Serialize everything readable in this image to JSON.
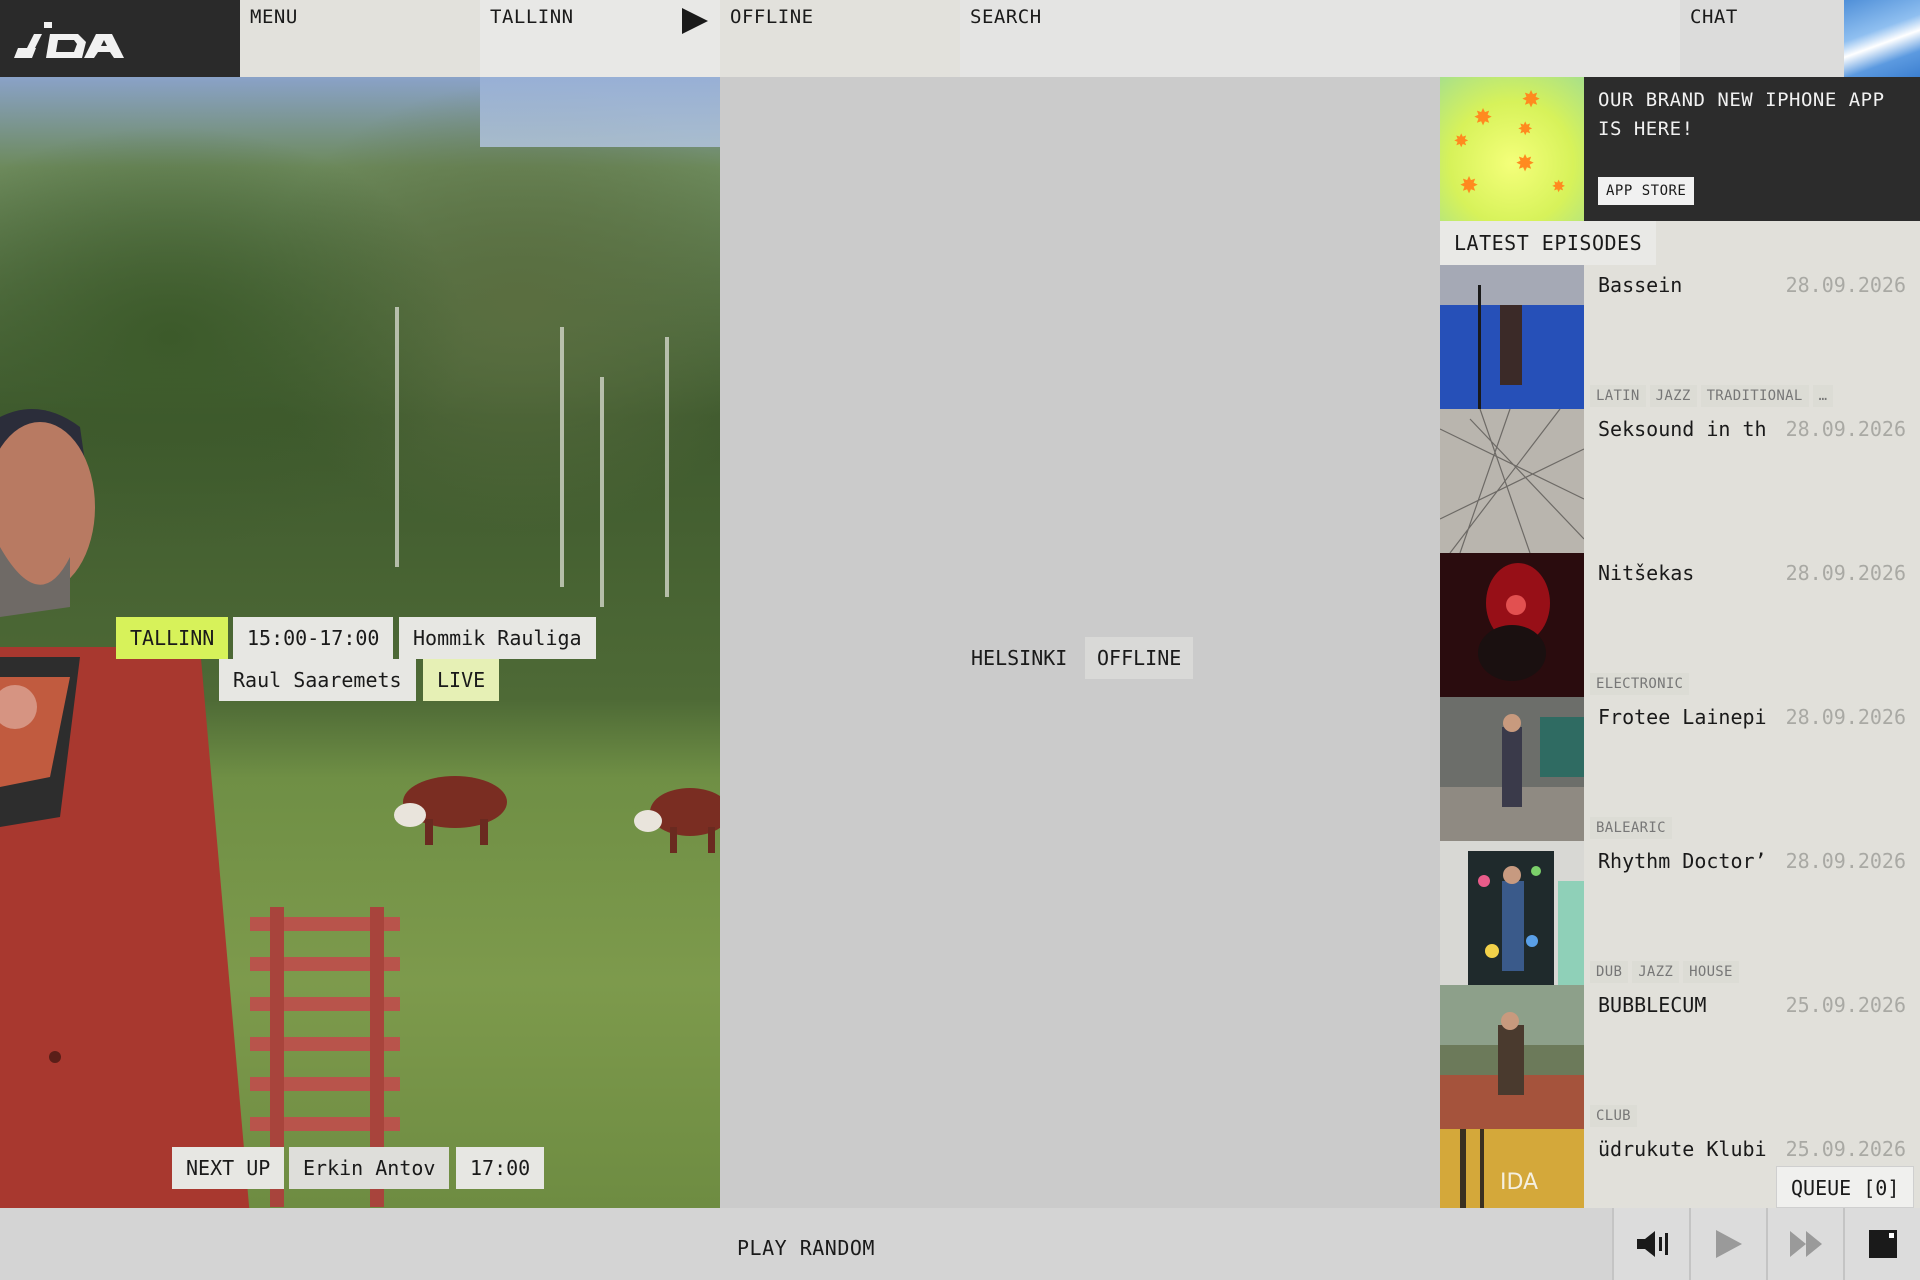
{
  "brand": {
    "logo_text": "IDA"
  },
  "nav": {
    "menu": "MENU",
    "tallinn": "TALLINN",
    "offline": "OFFLINE",
    "search": "SEARCH",
    "chat": "CHAT"
  },
  "tallinn_now": {
    "station": "TALLINN",
    "time": "15:00-17:00",
    "show": "Hommik Rauliga",
    "host": "Raul Saaremets",
    "status": "LIVE",
    "next_up_label": "NEXT UP",
    "next_host": "Erkin Antov",
    "next_time": "17:00"
  },
  "helsinki": {
    "station": "HELSINKI",
    "status": "OFFLINE"
  },
  "promo": {
    "text": "OUR BRAND NEW IPHONE APP IS HERE!",
    "button": "APP STORE"
  },
  "latest": {
    "label": "LATEST EPISODES",
    "episodes": [
      {
        "title": "Bassein",
        "date": "28.09.2026",
        "tags": [
          "LATIN",
          "JAZZ",
          "TRADITIONAL",
          "…"
        ]
      },
      {
        "title": "Seksound in th",
        "date": "28.09.2026",
        "tags": []
      },
      {
        "title": "Nitšekas",
        "date": "28.09.2026",
        "tags": [
          "ELECTRONIC"
        ]
      },
      {
        "title": "Frotee Lainepi",
        "date": "28.09.2026",
        "tags": [
          "BALEARIC"
        ]
      },
      {
        "title": "Rhythm Doctor’",
        "date": "28.09.2026",
        "tags": [
          "DUB",
          "JAZZ",
          "HOUSE"
        ]
      },
      {
        "title": "BUBBLECUM",
        "date": "25.09.2026",
        "tags": [
          "CLUB"
        ]
      },
      {
        "title": "üdrukute Klubi",
        "date": "25.09.2026",
        "tags": []
      }
    ]
  },
  "queue": {
    "label": "QUEUE [0]"
  },
  "player": {
    "play_random": "PLAY RANDOM",
    "controls": [
      "volume-icon",
      "play-icon",
      "fast-forward-icon",
      "fullscreen-icon"
    ]
  },
  "colors": {
    "accent": "#d7f25a",
    "dark": "#2a2a2a",
    "panel": "#e1e0da"
  }
}
